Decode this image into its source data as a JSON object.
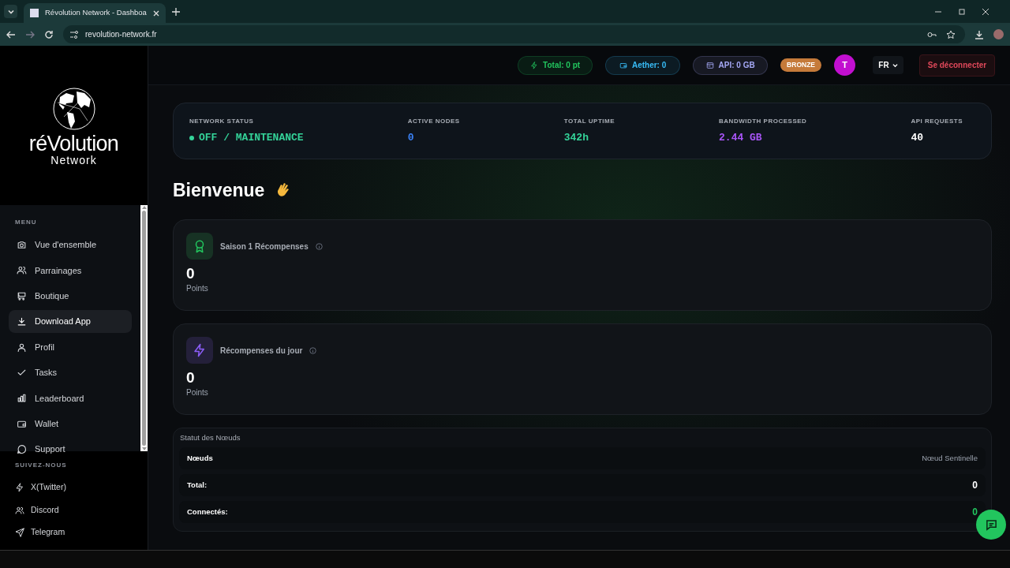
{
  "browser": {
    "tab_title": "Révolution Network - Dashboa",
    "url": "revolution-network.fr"
  },
  "logo": {
    "line_1": "réVolution",
    "line_2": "Network"
  },
  "sidebar": {
    "menu_heading": "MENU",
    "items": [
      {
        "label": "Vue d'ensemble",
        "selected": false
      },
      {
        "label": "Parrainages",
        "selected": false
      },
      {
        "label": "Boutique",
        "selected": false
      },
      {
        "label": "Download App",
        "selected": true
      },
      {
        "label": "Profil",
        "selected": false
      },
      {
        "label": "Tasks",
        "selected": false
      },
      {
        "label": "Leaderboard",
        "selected": false
      },
      {
        "label": "Wallet",
        "selected": false
      },
      {
        "label": "Support",
        "selected": false
      }
    ],
    "social_heading": "SUIVEZ-NOUS",
    "social": [
      {
        "label": "X(Twitter)"
      },
      {
        "label": "Discord"
      },
      {
        "label": "Telegram"
      }
    ]
  },
  "header": {
    "pills": [
      {
        "label": "Total: 0 pt",
        "color": "#22c55e"
      },
      {
        "label": "Aether: 0",
        "color": "#38bdf8"
      },
      {
        "label": "API: 0 GB",
        "color": "#a5a8f5"
      }
    ],
    "rank": "BRONZE",
    "avatar": "T",
    "language": "FR",
    "logout": "Se déconnecter"
  },
  "stats": [
    {
      "label": "NETWORK STATUS",
      "value": "OFF / MAINTENANCE",
      "color": "#34d399",
      "dot": true
    },
    {
      "label": "ACTIVE NODES",
      "value": "0",
      "color": "#3b82f6",
      "dot": false
    },
    {
      "label": "TOTAL UPTIME",
      "value": "342h",
      "color": "#34d399",
      "dot": false
    },
    {
      "label": "BANDWIDTH PROCESSED",
      "value": "2.44 GB",
      "color": "#a855f7",
      "dot": false
    },
    {
      "label": "API REQUESTS",
      "value": "40",
      "color": "#ffffff",
      "dot": false
    }
  ],
  "welcome": "Bienvenue",
  "reward_cards": [
    {
      "title": "Saison 1 Récompenses",
      "value": "0",
      "unit": "Points"
    },
    {
      "title": "Récompenses du jour",
      "value": "0",
      "unit": "Points"
    }
  ],
  "nodes": {
    "title": "Statut des Nœuds",
    "rows": [
      {
        "label": "Nœuds",
        "value": "Nœud Sentinelle",
        "color": "#9ca3af"
      },
      {
        "label": "Total:",
        "value": "0",
        "color": "#ffffff"
      },
      {
        "label": "Connectés:",
        "value": "0",
        "color": "#22c55e"
      }
    ]
  }
}
